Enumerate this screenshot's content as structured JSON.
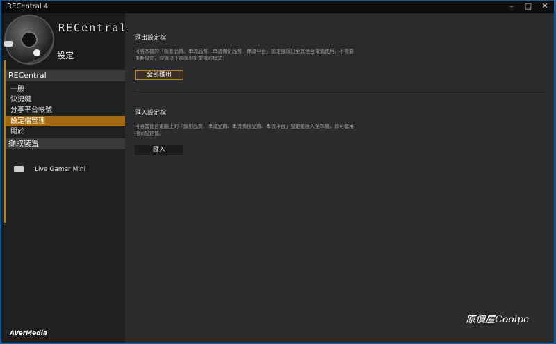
{
  "window": {
    "title": "RECentral 4"
  },
  "window_buttons": {
    "minimize": "–",
    "maximize": "□",
    "close": "✕"
  },
  "header": {
    "brand": "RECentral",
    "page_title": "設定"
  },
  "sidebar": {
    "sections": [
      {
        "label": "RECentral"
      },
      {
        "label": "擷取裝置"
      }
    ],
    "items": [
      {
        "label": "一般"
      },
      {
        "label": "快捷鍵"
      },
      {
        "label": "分享平台帳號"
      },
      {
        "label": "設定檔管理",
        "active": true
      },
      {
        "label": "關於"
      }
    ],
    "device": {
      "label": "Live Gamer Mini",
      "icon": "device-icon"
    },
    "footer": "AVerMedia"
  },
  "main": {
    "export": {
      "heading": "匯出設定檔",
      "description": "可將本機的「錄影品質、串流品質、串流備份品質、串流平台」設定值匯出至其他台電腦使用，不需要重新設定，勾選以下欲匯出設定檔的模式：",
      "button": "全部匯出"
    },
    "import": {
      "heading": "匯入設定檔",
      "description": "可將其他台電腦上的「錄影品質、串流品質、串流備份品質、串流平台」設定值匯入至本機，即可套用相同設定值。",
      "button": "匯入"
    }
  },
  "watermark": "原價屋Coolpc",
  "colors": {
    "accent": "#a36a12",
    "background": "#2b2b2b",
    "sidebar": "#202020"
  }
}
